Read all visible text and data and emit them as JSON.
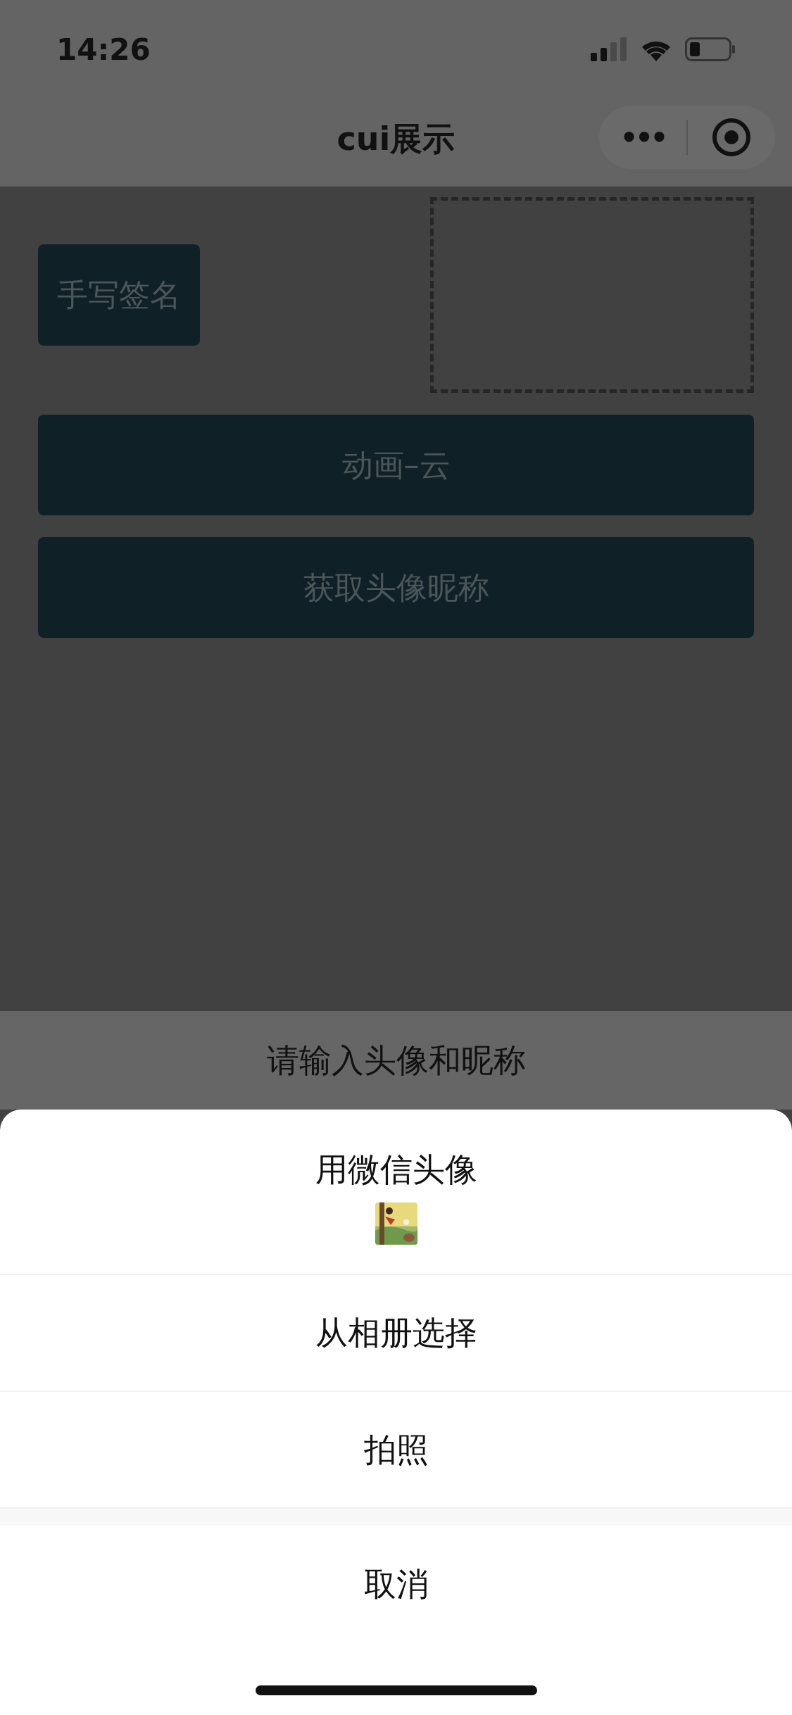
{
  "status_bar": {
    "time": "14:26"
  },
  "nav_bar": {
    "title": "cui展示",
    "more_button": "•••"
  },
  "buttons": [
    {
      "label": "手写签名",
      "kind": "small"
    },
    {
      "label": "动画–云",
      "kind": "wide"
    },
    {
      "label": "获取头像昵称",
      "kind": "wide"
    }
  ],
  "action_sheet": {
    "title": "请输入头像和昵称",
    "options": [
      {
        "label": "用微信头像",
        "kind": "with-picture"
      },
      {
        "label": "从相册选择",
        "kind": "plain"
      },
      {
        "label": "拍照",
        "kind": "plain"
      }
    ],
    "cancel": "取消"
  }
}
